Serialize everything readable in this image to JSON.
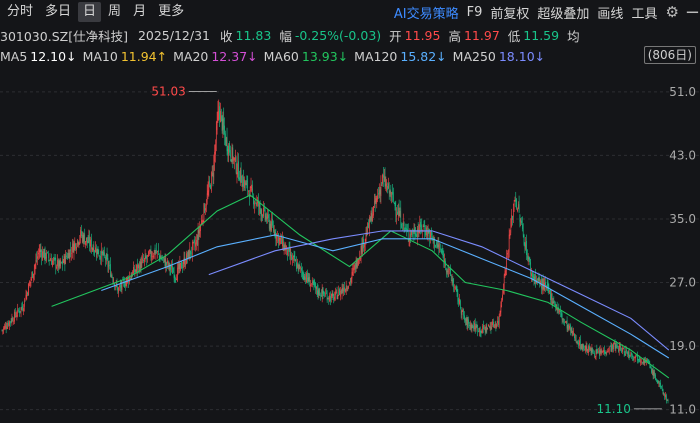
{
  "toolbar": {
    "tabs": [
      "分时",
      "多日",
      "日",
      "周",
      "月",
      "更多"
    ],
    "active_tab": "日",
    "tools": [
      {
        "label": "AI交易策略",
        "accent": true
      },
      {
        "label": "F9",
        "accent": false
      },
      {
        "label": "前复权",
        "accent": false
      },
      {
        "label": "超级叠加",
        "accent": false
      },
      {
        "label": "画线",
        "accent": false
      },
      {
        "label": "工具",
        "accent": false
      }
    ],
    "settings_icon": "gear-icon",
    "minimize_icon": "minus-icon"
  },
  "info": {
    "code": "301030.SZ[仕净科技]",
    "date": "2025/12/31",
    "close_label": "收",
    "close": "11.83",
    "change_label": "幅",
    "change": "-0.25%(-0.03)",
    "open_label": "开",
    "open": "11.95",
    "high_label": "高",
    "high": "11.97",
    "low_label": "低",
    "low": "11.59",
    "avg_label": "均"
  },
  "ma": [
    {
      "name": "MA5",
      "value": "12.10",
      "arrow": "↓",
      "color": "#ffffff"
    },
    {
      "name": "MA10",
      "value": "11.94",
      "arrow": "↑",
      "color": "#f2c230"
    },
    {
      "name": "MA20",
      "value": "12.37",
      "arrow": "↓",
      "color": "#d44fd6"
    },
    {
      "name": "MA60",
      "value": "13.93",
      "arrow": "↓",
      "color": "#22c55e"
    },
    {
      "name": "MA120",
      "value": "15.82",
      "arrow": "↓",
      "color": "#5ab0ff"
    },
    {
      "name": "MA250",
      "value": "18.10",
      "arrow": "↓",
      "color": "#7b8cff"
    }
  ],
  "days_label": "(806日)",
  "colors": {
    "up": "#ff4a4a",
    "down": "#19c48a",
    "accent": "#3d8bff",
    "background": "#141518"
  },
  "chart_data": {
    "type": "candlestick",
    "y_ticks": [
      "51.0",
      "43.0",
      "35.0",
      "27.0",
      "19.0",
      "11.0"
    ],
    "y_tick_values": [
      51,
      43,
      35,
      27,
      19,
      11
    ],
    "ylim": [
      10.2,
      53.5
    ],
    "bars": 806,
    "annotations": [
      {
        "label": "51.03",
        "value": 51.03,
        "kind": "high"
      },
      {
        "label": "11.10",
        "value": 11.1,
        "kind": "low"
      }
    ],
    "close_anchors": [
      [
        0,
        21
      ],
      [
        25,
        24
      ],
      [
        45,
        31
      ],
      [
        70,
        29
      ],
      [
        95,
        33
      ],
      [
        125,
        30
      ],
      [
        140,
        26
      ],
      [
        165,
        29
      ],
      [
        185,
        31
      ],
      [
        210,
        28
      ],
      [
        235,
        32
      ],
      [
        255,
        41
      ],
      [
        262,
        49
      ],
      [
        270,
        45
      ],
      [
        290,
        40
      ],
      [
        320,
        35
      ],
      [
        350,
        30
      ],
      [
        380,
        26
      ],
      [
        400,
        25
      ],
      [
        420,
        27
      ],
      [
        440,
        33
      ],
      [
        460,
        40
      ],
      [
        470,
        38
      ],
      [
        490,
        33
      ],
      [
        510,
        34
      ],
      [
        530,
        31
      ],
      [
        545,
        27
      ],
      [
        560,
        22
      ],
      [
        580,
        21
      ],
      [
        600,
        22
      ],
      [
        620,
        38
      ],
      [
        640,
        28
      ],
      [
        660,
        26
      ],
      [
        680,
        22
      ],
      [
        700,
        19
      ],
      [
        720,
        18
      ],
      [
        740,
        19
      ],
      [
        760,
        18
      ],
      [
        780,
        17
      ],
      [
        800,
        13
      ],
      [
        806,
        11.8
      ]
    ],
    "ma_series": [
      {
        "name": "MA60",
        "color": "#22c55e",
        "values": [
          [
            60,
            24
          ],
          [
            150,
            27.5
          ],
          [
            200,
            30.5
          ],
          [
            260,
            36
          ],
          [
            300,
            38
          ],
          [
            360,
            33
          ],
          [
            420,
            29
          ],
          [
            470,
            33.5
          ],
          [
            520,
            31
          ],
          [
            560,
            27
          ],
          [
            610,
            26
          ],
          [
            660,
            24.5
          ],
          [
            700,
            22
          ],
          [
            760,
            18.5
          ],
          [
            806,
            15
          ]
        ]
      },
      {
        "name": "MA120",
        "color": "#5ab0ff",
        "values": [
          [
            120,
            26
          ],
          [
            200,
            29
          ],
          [
            260,
            31.5
          ],
          [
            330,
            33
          ],
          [
            400,
            31
          ],
          [
            460,
            32.5
          ],
          [
            520,
            32.5
          ],
          [
            580,
            30
          ],
          [
            640,
            27.5
          ],
          [
            700,
            24
          ],
          [
            760,
            20.5
          ],
          [
            806,
            17.5
          ]
        ]
      },
      {
        "name": "MA250",
        "color": "#7b8cff",
        "values": [
          [
            250,
            28
          ],
          [
            330,
            31
          ],
          [
            400,
            32.5
          ],
          [
            460,
            33.5
          ],
          [
            520,
            33.5
          ],
          [
            580,
            31.5
          ],
          [
            640,
            28.5
          ],
          [
            700,
            25.5
          ],
          [
            760,
            22.5
          ],
          [
            806,
            18.5
          ]
        ]
      }
    ]
  }
}
